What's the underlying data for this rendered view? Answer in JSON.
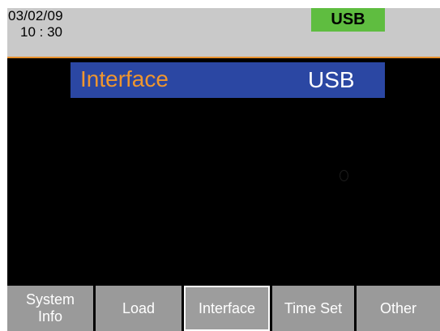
{
  "status_bar": {
    "date": "03/02/09",
    "time": "10 : 30",
    "interface_badge": "USB",
    "badge_color": "#5fbd40",
    "background_color": "#c9c9c9",
    "separator_color": "#e8902c"
  },
  "menu": {
    "item_label": "Interface",
    "item_value": "USB",
    "highlight_color": "#2b47a3",
    "label_color": "#f0962e"
  },
  "softkeys": [
    {
      "label": "System\nInfo",
      "selected": false
    },
    {
      "label": "Load",
      "selected": false
    },
    {
      "label": "Interface",
      "selected": true
    },
    {
      "label": "Time Set",
      "selected": false
    },
    {
      "label": "Other",
      "selected": false
    }
  ]
}
